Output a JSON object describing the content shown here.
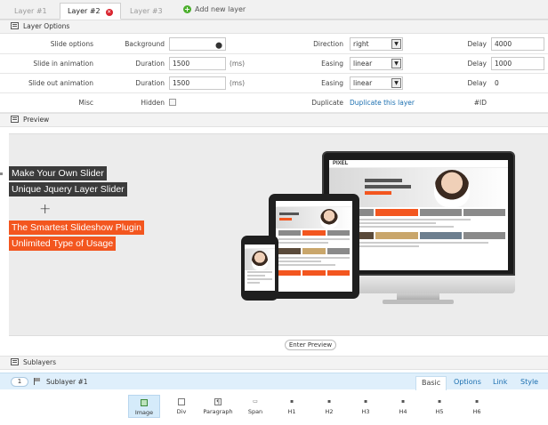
{
  "tabs": [
    {
      "label": "Layer #1",
      "active": false
    },
    {
      "label": "Layer #2",
      "active": true,
      "close_icon": "close-icon",
      "close_color": "#d9232e"
    },
    {
      "label": "Layer #3",
      "active": false
    }
  ],
  "add_layer": {
    "label": "Add new layer",
    "icon": "plus-circle-icon",
    "color": "#4caf2d"
  },
  "layer_options": {
    "title": "Layer Options",
    "rows": [
      {
        "label": "Slide options",
        "c1_label": "Background",
        "c1_value": "",
        "c2_label": "Direction",
        "c2_value": "right",
        "c3_label": "Delay",
        "c3_value": "4000"
      },
      {
        "label": "Slide in animation",
        "c1_label": "Duration",
        "c1_value": "1500",
        "c1_unit": "(ms)",
        "c2_label": "Easing",
        "c2_value": "linear",
        "c3_label": "Delay",
        "c3_value": "1000"
      },
      {
        "label": "Slide out animation",
        "c1_label": "Duration",
        "c1_value": "1500",
        "c1_unit": "(ms)",
        "c2_label": "Easing",
        "c2_value": "linear",
        "c3_label": "Delay",
        "c3_value": "0"
      },
      {
        "label": "Misc",
        "c1_label": "Hidden",
        "c2_label": "Duplicate",
        "c2_value": "Duplicate this layer",
        "c3_label": "#ID"
      }
    ]
  },
  "preview": {
    "title": "Preview",
    "captions": [
      "Make Your Own Slider",
      "Unique Jquery Layer Slider",
      "The Smartest Slideshow Plugin",
      "Unlimited Type of Usage"
    ],
    "site_logo": "PIXEL",
    "caption_dark": "#3b3b3b",
    "caption_orange": "#f3561f"
  },
  "enter_preview": "Enter Preview",
  "sublayers": {
    "title": "Sublayers",
    "number": "1",
    "name": "Sublayer #1",
    "tabs": [
      "Basic",
      "Options",
      "Link",
      "Style"
    ],
    "active_tab": "Basic"
  },
  "types": [
    {
      "label": "Image",
      "icon": "image-icon",
      "active": true
    },
    {
      "label": "Div",
      "icon": "div-icon"
    },
    {
      "label": "Paragraph",
      "icon": "paragraph-icon"
    },
    {
      "label": "Span",
      "icon": "span-icon"
    },
    {
      "label": "H1",
      "icon": "h1-icon"
    },
    {
      "label": "H2",
      "icon": "h2-icon"
    },
    {
      "label": "H3",
      "icon": "h3-icon"
    },
    {
      "label": "H4",
      "icon": "h4-icon"
    },
    {
      "label": "H5",
      "icon": "h5-icon"
    },
    {
      "label": "H6",
      "icon": "h6-icon"
    }
  ]
}
